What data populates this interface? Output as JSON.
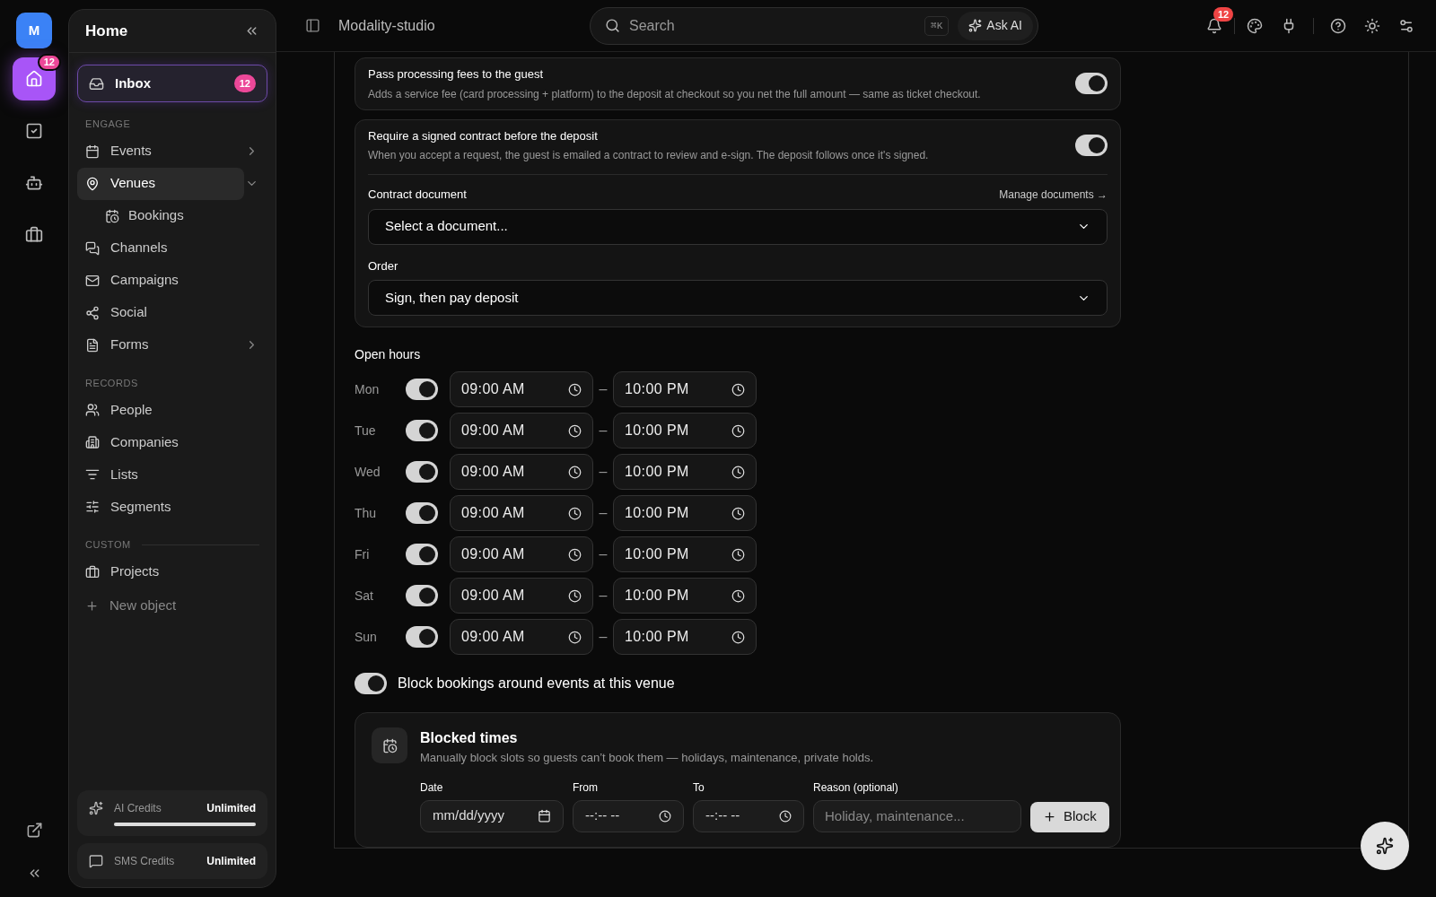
{
  "rail": {
    "avatar": "M",
    "items": [
      {
        "selected": true,
        "badge": "12"
      },
      {
        "selected": false
      },
      {
        "selected": false
      },
      {
        "selected": false
      }
    ]
  },
  "sidebar": {
    "title": "Home",
    "inbox": {
      "label": "Inbox",
      "badge": "12",
      "selected": true
    },
    "sections": [
      {
        "heading": "ENGAGE",
        "items": [
          {
            "label": "Events",
            "selected": false,
            "expanded": false
          },
          {
            "label": "Venues",
            "selected": true,
            "expanded": true,
            "children": [
              {
                "label": "Bookings",
                "selected": false
              }
            ]
          },
          {
            "label": "Channels",
            "selected": false
          },
          {
            "label": "Campaigns",
            "selected": false
          },
          {
            "label": "Social",
            "selected": false
          },
          {
            "label": "Forms",
            "selected": false,
            "expanded": false
          }
        ]
      },
      {
        "heading": "RECORDS",
        "items": [
          {
            "label": "People",
            "selected": false
          },
          {
            "label": "Companies",
            "selected": false
          },
          {
            "label": "Lists",
            "selected": false
          },
          {
            "label": "Segments",
            "selected": false
          }
        ]
      },
      {
        "heading": "CUSTOM",
        "items": [
          {
            "label": "Projects",
            "selected": false
          }
        ]
      }
    ],
    "new_object": "New object",
    "credits": [
      {
        "label": "AI Credits",
        "value": "Unlimited",
        "level": 1
      },
      {
        "label": "SMS Credits",
        "value": "Unlimited"
      }
    ]
  },
  "header": {
    "workspace": "Modality-studio",
    "search": {
      "placeholder": "Search",
      "shortcut": "⌘K",
      "ask_ai": "Ask AI"
    },
    "notifications": "12"
  },
  "settings": [
    {
      "title": "Pass processing fees to the guest",
      "description": "Adds a service fee (card processing + platform) to the deposit at checkout so you net the full amount — same as ticket checkout.",
      "on": true
    },
    {
      "title": "Require a signed contract before the deposit",
      "description": "When you accept a request, the guest is emailed a contract to review and e-sign. The deposit follows once it's signed.",
      "on": true,
      "contract_label": "Contract document",
      "manage_link": "Manage documents →",
      "contract_value": "Select a document...",
      "order_label": "Order",
      "order_value": "Sign, then pay deposit"
    }
  ],
  "open_hours": {
    "title": "Open hours",
    "days": [
      {
        "day": "Mon",
        "on": true,
        "from": "09:00 AM",
        "to": "10:00 PM"
      },
      {
        "day": "Tue",
        "on": true,
        "from": "09:00 AM",
        "to": "10:00 PM"
      },
      {
        "day": "Wed",
        "on": true,
        "from": "09:00 AM",
        "to": "10:00 PM"
      },
      {
        "day": "Thu",
        "on": true,
        "from": "09:00 AM",
        "to": "10:00 PM"
      },
      {
        "day": "Fri",
        "on": true,
        "from": "09:00 AM",
        "to": "10:00 PM"
      },
      {
        "day": "Sat",
        "on": true,
        "from": "09:00 AM",
        "to": "10:00 PM"
      },
      {
        "day": "Sun",
        "on": true,
        "from": "09:00 AM",
        "to": "10:00 PM"
      }
    ],
    "separator": "–"
  },
  "block_events": {
    "label": "Block bookings around events at this venue",
    "on": true
  },
  "blocked_times": {
    "title": "Blocked times",
    "description": "Manually block slots so guests can’t book them — holidays, maintenance, private holds.",
    "date_label": "Date",
    "date_placeholder": "mm/dd/yyyy",
    "from_label": "From",
    "from_placeholder": "--:-- --",
    "to_label": "To",
    "to_placeholder": "--:-- --",
    "reason_label": "Reason (optional)",
    "reason_placeholder": "Holiday, maintenance...",
    "button": "Block"
  }
}
